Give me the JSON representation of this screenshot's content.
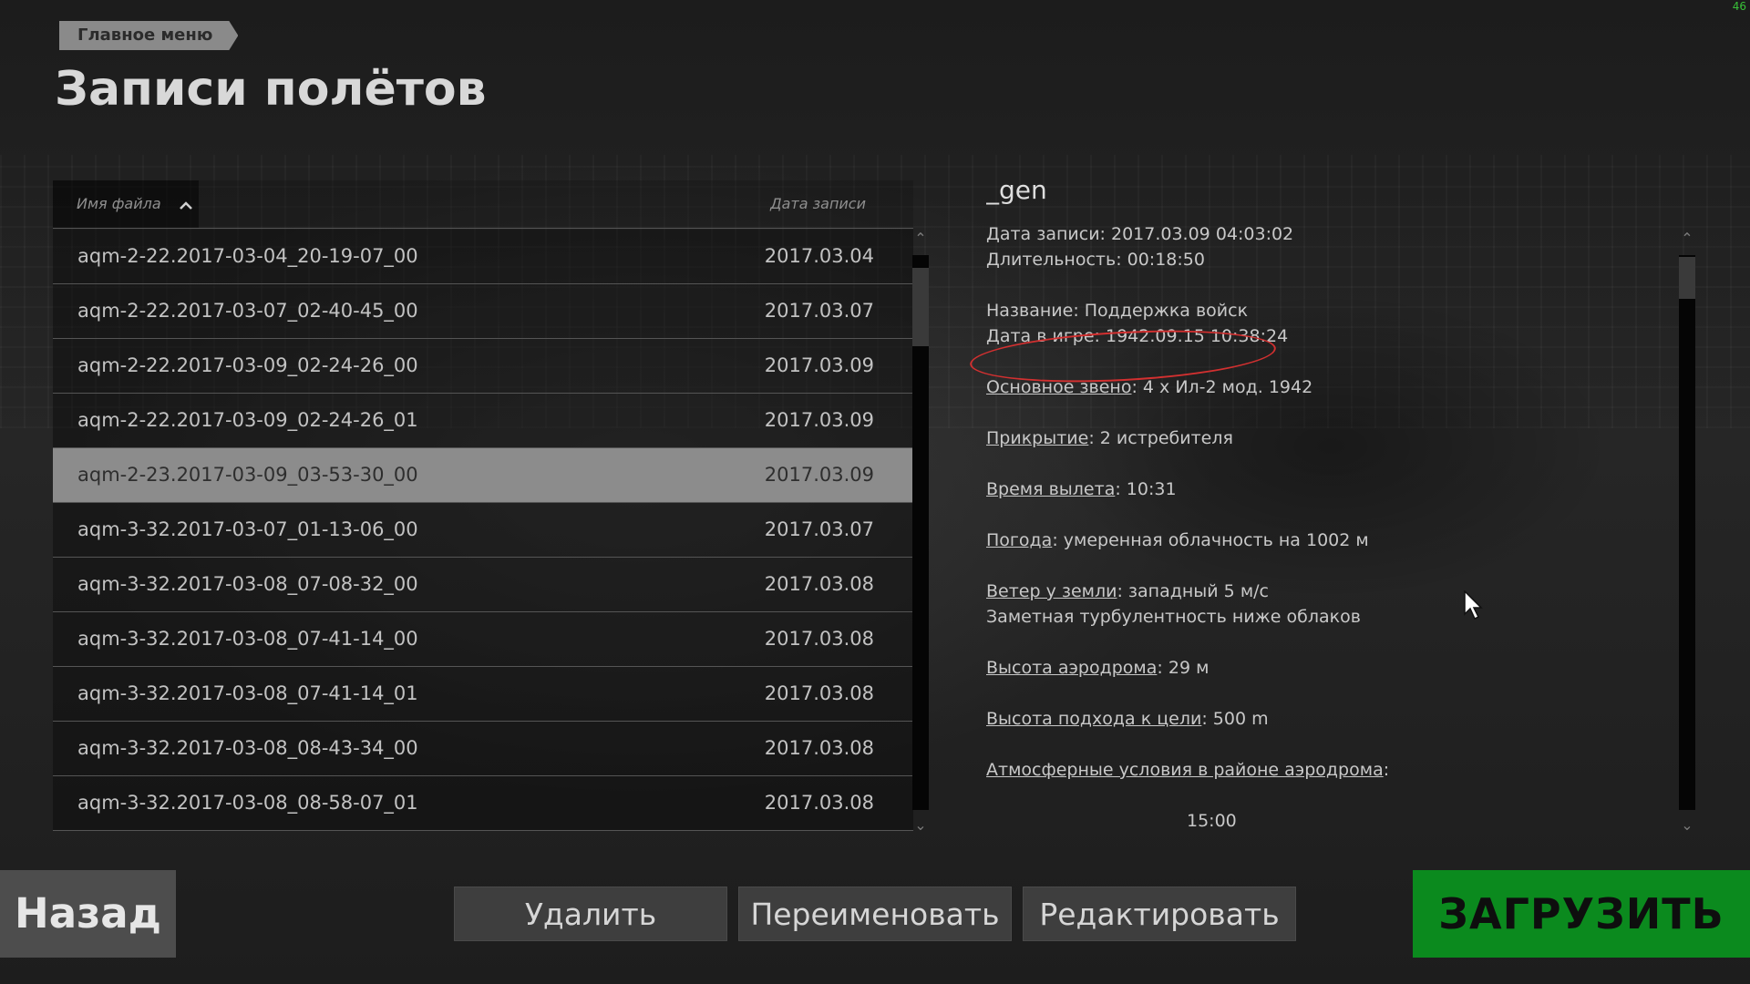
{
  "breadcrumb": {
    "label": "Главное меню"
  },
  "page": {
    "title": "Записи полётов"
  },
  "fps": "46",
  "list": {
    "columns": {
      "name": "Имя файла",
      "date": "Дата записи"
    },
    "rows": [
      {
        "name": "aqm-2-22.2017-03-04_20-19-07_00",
        "date": "2017.03.04"
      },
      {
        "name": "aqm-2-22.2017-03-07_02-40-45_00",
        "date": "2017.03.07"
      },
      {
        "name": "aqm-2-22.2017-03-09_02-24-26_00",
        "date": "2017.03.09"
      },
      {
        "name": "aqm-2-22.2017-03-09_02-24-26_01",
        "date": "2017.03.09"
      },
      {
        "name": "aqm-2-23.2017-03-09_03-53-30_00",
        "date": "2017.03.09"
      },
      {
        "name": "aqm-3-32.2017-03-07_01-13-06_00",
        "date": "2017.03.07"
      },
      {
        "name": "aqm-3-32.2017-03-08_07-08-32_00",
        "date": "2017.03.08"
      },
      {
        "name": "aqm-3-32.2017-03-08_07-41-14_00",
        "date": "2017.03.08"
      },
      {
        "name": "aqm-3-32.2017-03-08_07-41-14_01",
        "date": "2017.03.08"
      },
      {
        "name": "aqm-3-32.2017-03-08_08-43-34_00",
        "date": "2017.03.08"
      },
      {
        "name": "aqm-3-32.2017-03-08_08-58-07_01",
        "date": "2017.03.08"
      }
    ],
    "selected_index": 4
  },
  "details": {
    "title": "_gen",
    "record_date": "Дата записи: 2017.03.09 04:03:02",
    "duration": "Длительность: 00:18:50",
    "mission_name": "Название: Поддержка войск",
    "game_date": "Дата в игре: 1942.09.15 10:38:24",
    "main_flight_label": "Основное звено",
    "main_flight_value": ": 4 x Ил-2 мод. 1942",
    "escort_label": "Прикрытие",
    "escort_value": ": 2 истребителя",
    "departure_label": "Время вылета",
    "departure_value": ": 10:31",
    "weather_label": "Погода",
    "weather_value": ": умеренная облачность на 1002 м",
    "wind_label": "Ветер у земли",
    "wind_value": ": западный 5 м/с",
    "turbulence": "Заметная турбулентность ниже облаков",
    "airfield_alt_label": "Высота аэродрома",
    "airfield_alt_value": ": 29 м",
    "approach_alt_label": "Высота подхода к цели",
    "approach_alt_value": ": 500 m",
    "atmo_label": "Атмосферные условия в районе аэродрома",
    "atmo_value": ":",
    "cut_line": "15:00"
  },
  "buttons": {
    "back": "Назад",
    "delete": "Удалить",
    "rename": "Переименовать",
    "edit": "Редактировать",
    "load": "ЗАГРУЗИТЬ"
  },
  "colors": {
    "accent_green": "#0b8a1e",
    "annotation_red": "#d23030",
    "selected_row": "#8c8c8c"
  },
  "icons": {
    "sort": "chevron-up-icon",
    "scroll_up": "chevron-up-icon",
    "scroll_down": "chevron-down-icon",
    "cursor": "mouse-pointer-icon"
  }
}
